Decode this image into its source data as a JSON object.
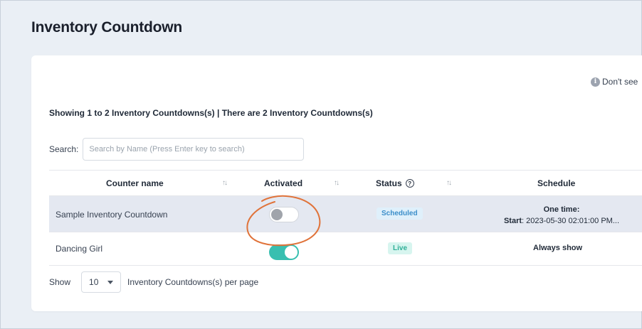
{
  "page": {
    "title": "Inventory Countdown"
  },
  "help_note": {
    "icon": "info-icon",
    "text": "Don't see"
  },
  "summary": "Showing 1 to 2 Inventory Countdowns(s) | There are 2 Inventory Countdowns(s)",
  "search": {
    "label": "Search:",
    "placeholder": "Search by Name (Press Enter key to search)",
    "value": ""
  },
  "table": {
    "headers": {
      "name": "Counter name",
      "activated": "Activated",
      "status": "Status",
      "schedule": "Schedule"
    },
    "sort_glyph": "↑↓",
    "help_glyph": "?",
    "rows": [
      {
        "name": "Sample Inventory Countdown",
        "activated": false,
        "status": "Scheduled",
        "schedule_line1": "One time:",
        "schedule_start_label": "Start",
        "schedule_start_value": ": 2023-05-30 02:01:00 PM..."
      },
      {
        "name": "Dancing Girl",
        "activated": true,
        "status": "Live",
        "schedule_text": "Always show"
      }
    ]
  },
  "pagination": {
    "show_label": "Show",
    "page_size": "10",
    "per_page_label": "Inventory Countdowns(s) per page"
  },
  "colors": {
    "toggle_on": "#38bfb0",
    "annotation": "#e0733a",
    "badge_scheduled": "#3b8ec9",
    "badge_live": "#2faf97"
  }
}
